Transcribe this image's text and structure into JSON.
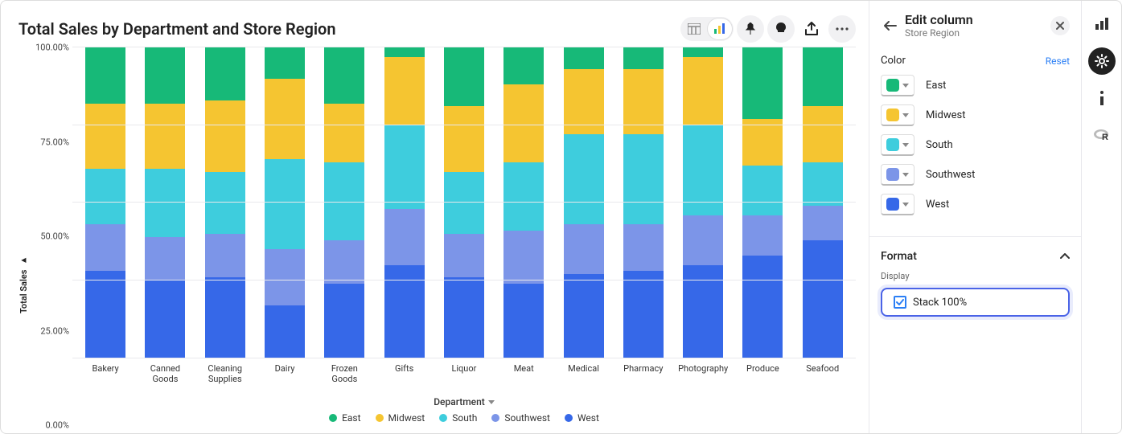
{
  "title": "Total Sales by Department and Store Region",
  "y_label": "Total Sales",
  "x_label": "Department",
  "y_ticks": [
    "0.00%",
    "25.00%",
    "50.00%",
    "75.00%",
    "100.00%"
  ],
  "regions": [
    {
      "name": "East",
      "color": "#17b978"
    },
    {
      "name": "Midwest",
      "color": "#f5c531"
    },
    {
      "name": "South",
      "color": "#3ecddd"
    },
    {
      "name": "Southwest",
      "color": "#7c95e8"
    },
    {
      "name": "West",
      "color": "#3668e8"
    }
  ],
  "sidepanel": {
    "title": "Edit column",
    "subtitle": "Store Region",
    "color_label": "Color",
    "reset_label": "Reset",
    "format_label": "Format",
    "display_label": "Display",
    "stack_label": "Stack 100%",
    "stack_checked": true
  },
  "chart_data": {
    "type": "bar",
    "stacked": "100%",
    "title": "Total Sales by Department and Store Region",
    "xlabel": "Department",
    "ylabel": "Total Sales",
    "ylim": [
      0,
      100
    ],
    "y_format": "percent",
    "categories": [
      "Bakery",
      "Canned Goods",
      "Cleaning Supplies",
      "Dairy",
      "Frozen Goods",
      "Gifts",
      "Liquor",
      "Meat",
      "Medical",
      "Pharmacy",
      "Photography",
      "Produce",
      "Seafood"
    ],
    "series": [
      {
        "name": "West",
        "color": "#3668e8",
        "values": [
          28,
          25,
          26,
          17,
          24,
          30,
          26,
          24,
          27,
          28,
          30,
          33,
          38
        ]
      },
      {
        "name": "Southwest",
        "color": "#7c95e8",
        "values": [
          15,
          14,
          14,
          18,
          14,
          18,
          14,
          17,
          16,
          15,
          16,
          13,
          11
        ]
      },
      {
        "name": "South",
        "color": "#3ecddd",
        "values": [
          18,
          22,
          20,
          29,
          25,
          27,
          20,
          22,
          29,
          29,
          29,
          16,
          14
        ]
      },
      {
        "name": "Midwest",
        "color": "#f5c531",
        "values": [
          21,
          21,
          23,
          26,
          19,
          22,
          21,
          25,
          21,
          21,
          22,
          15,
          18
        ]
      },
      {
        "name": "East",
        "color": "#17b978",
        "values": [
          18,
          18,
          17,
          10,
          18,
          3,
          19,
          12,
          7,
          7,
          3,
          23,
          19
        ]
      }
    ]
  }
}
